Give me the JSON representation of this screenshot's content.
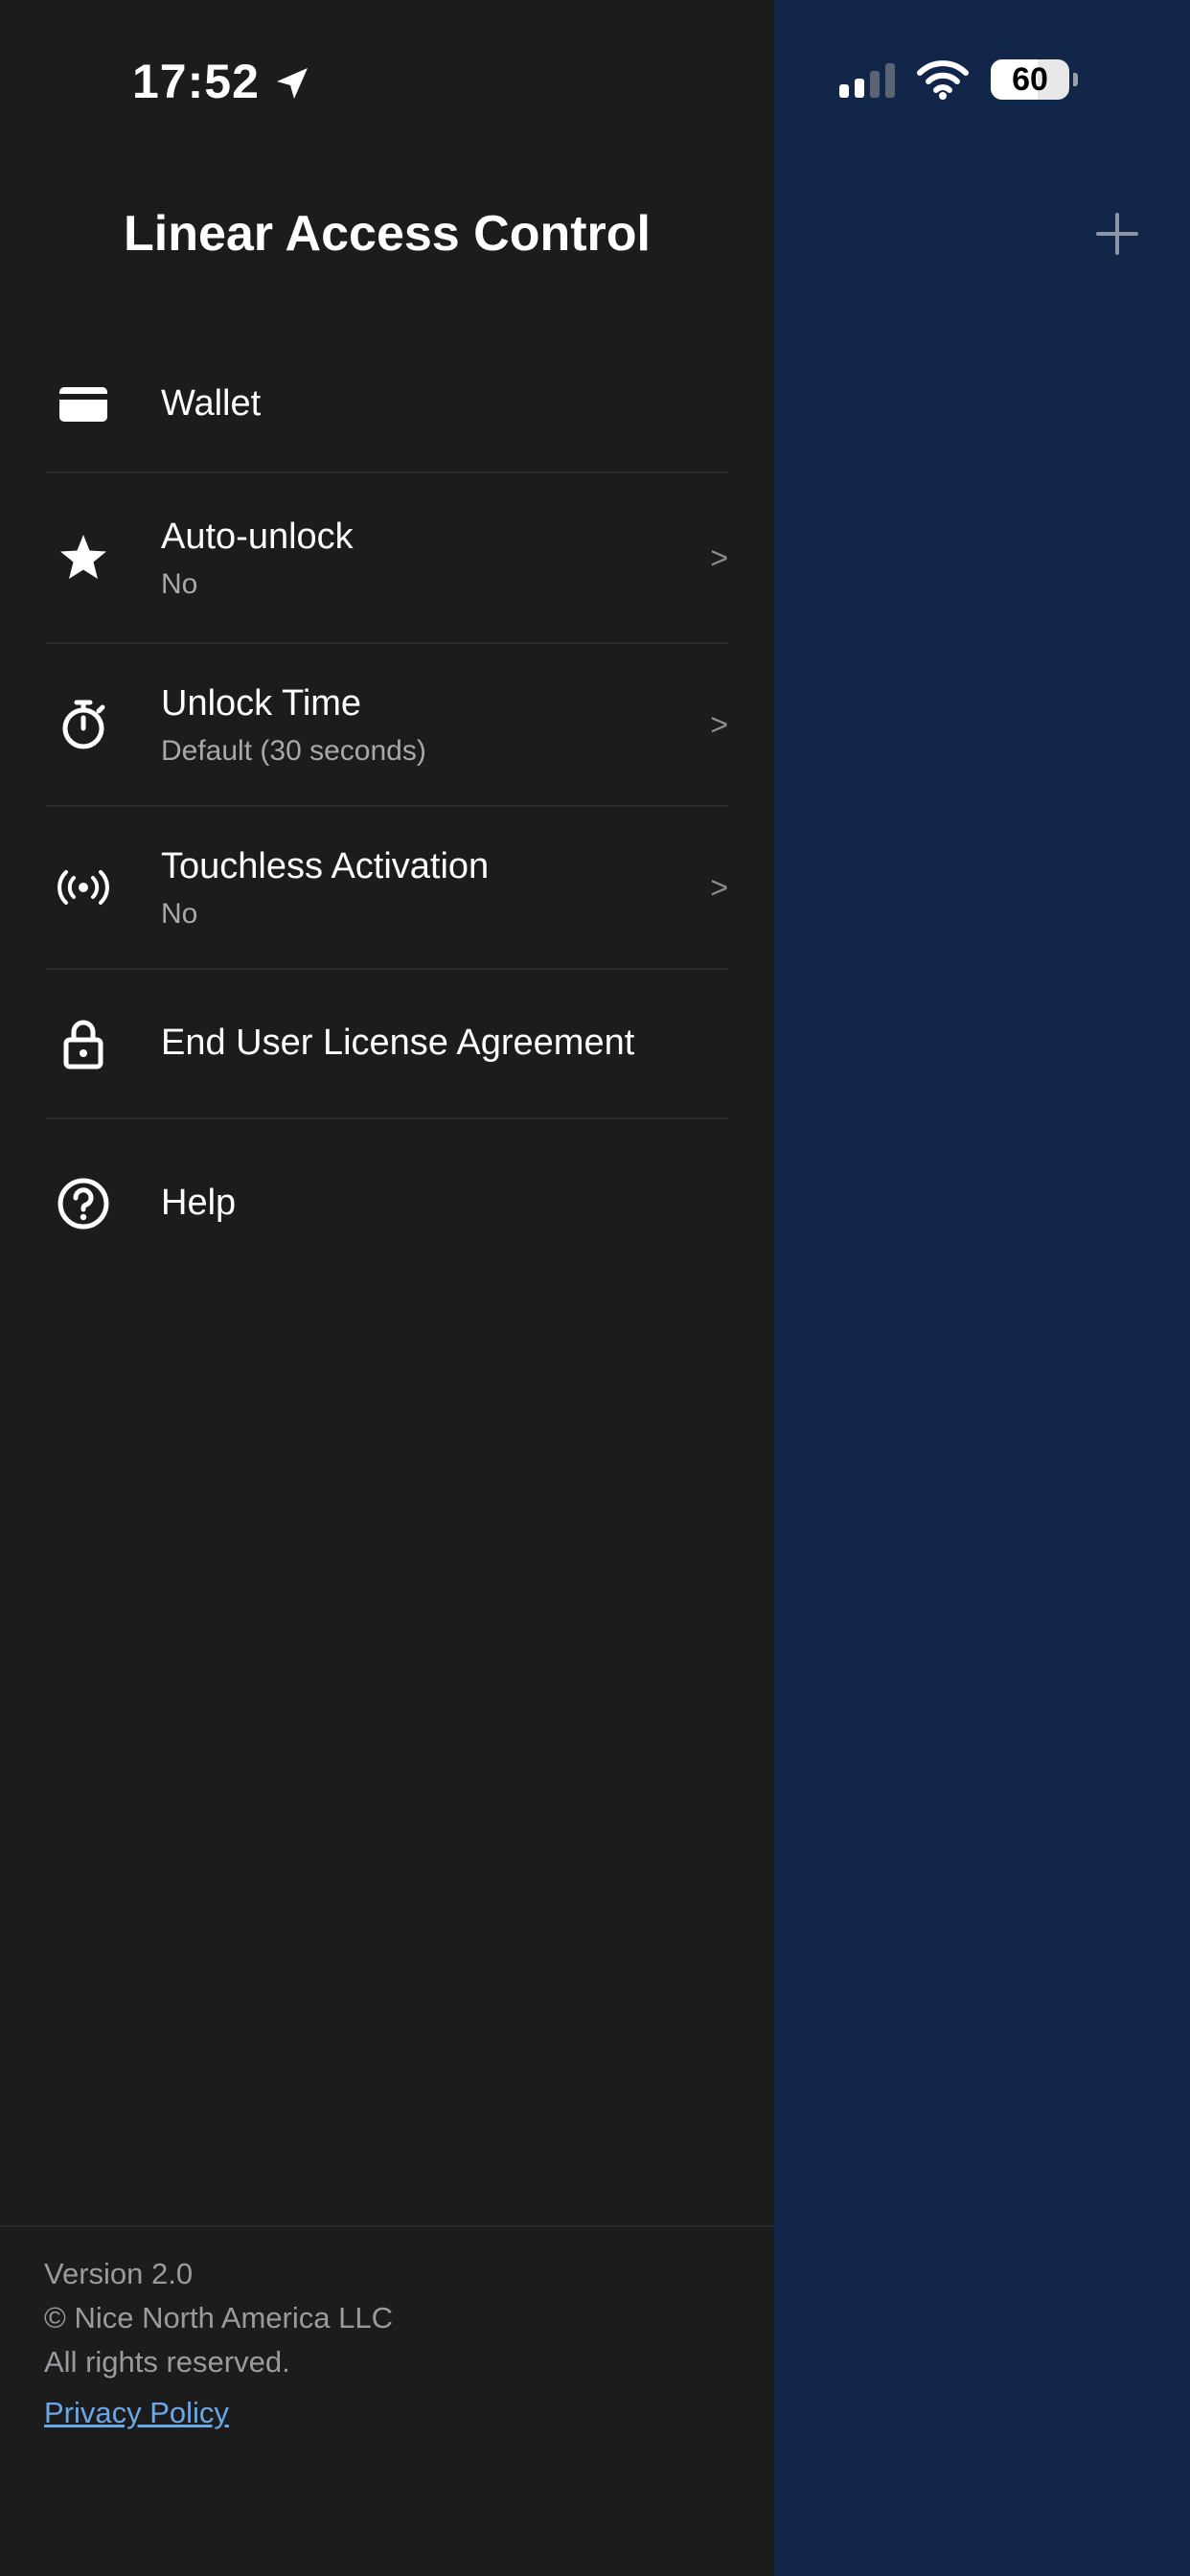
{
  "status_bar": {
    "time": "17:52",
    "battery": "60"
  },
  "drawer": {
    "title": "Linear Access Control",
    "items": [
      {
        "label": "Wallet",
        "sub": "",
        "icon": "card-icon",
        "has_chevron": false
      },
      {
        "label": "Auto-unlock",
        "sub": "No",
        "icon": "star-icon",
        "has_chevron": true
      },
      {
        "label": "Unlock Time",
        "sub": "Default (30 seconds)",
        "icon": "stopwatch-icon",
        "has_chevron": true
      },
      {
        "label": "Touchless Activation",
        "sub": "No",
        "icon": "broadcast-icon",
        "has_chevron": true
      },
      {
        "label": "End User License Agreement",
        "sub": "",
        "icon": "lock-icon",
        "has_chevron": false
      },
      {
        "label": "Help",
        "sub": "",
        "icon": "help-icon",
        "has_chevron": false
      }
    ],
    "chevron": ">",
    "footer": {
      "version": "Version 2.0",
      "copyright": "© Nice North America LLC",
      "rights": "All rights reserved.",
      "privacy_link": "Privacy Policy"
    }
  },
  "colors": {
    "drawer_bg": "#1c1c1d",
    "main_bg": "#12264a",
    "link": "#6aa8ea"
  }
}
